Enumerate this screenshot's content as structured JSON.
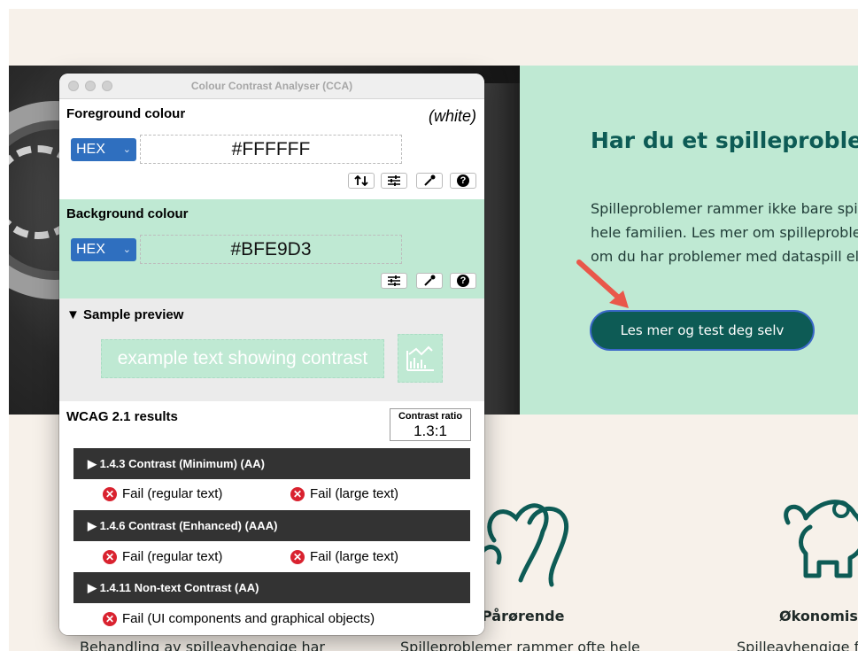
{
  "webpage": {
    "hero_title": "Har du et spilleproblem?",
    "hero_lines": [
      "Spilleproblemer rammer ikke bare spilleren, men",
      "hele familien. Les mer om spilleproblemer og hvor",
      "om du har problemer med dataspill eller pengespill."
    ],
    "hero_button": "Les mer og test deg selv",
    "cards": [
      {
        "title": "Pårørende",
        "text": "Spilleproblemer rammer ofte hele"
      },
      {
        "title": "Økonomisk",
        "text": "Spilleavhengige får"
      }
    ],
    "left_card_text": "Behandling av spilleavhengige har",
    "colors": {
      "page_bg": "#f7f1ea",
      "hero_bg": "#bfe9d3",
      "brand": "#0d5b55"
    }
  },
  "cca": {
    "window_title": "Colour Contrast Analyser (CCA)",
    "foreground": {
      "label": "Foreground colour",
      "name": "(white)",
      "format": "HEX",
      "value": "#FFFFFF"
    },
    "background": {
      "label": "Background colour",
      "format": "HEX",
      "value": "#BFE9D3"
    },
    "preview": {
      "label": "▼ Sample preview",
      "sample_text": "example text showing contrast"
    },
    "results": {
      "label": "WCAG 2.1 results",
      "ratio_label": "Contrast ratio",
      "ratio_value": "1.3:1",
      "criteria": [
        {
          "label": "▶ 1.4.3 Contrast (Minimum) (AA)",
          "items": [
            "Fail (regular text)",
            "Fail (large text)"
          ]
        },
        {
          "label": "▶ 1.4.6 Contrast (Enhanced) (AAA)",
          "items": [
            "Fail (regular text)",
            "Fail (large text)"
          ]
        },
        {
          "label": "▶ 1.4.11 Non-text Contrast (AA)",
          "items": [
            "Fail (UI components and graphical objects)"
          ]
        }
      ]
    },
    "tool_icons": [
      "swap-icon",
      "sliders-icon",
      "eyedropper-icon",
      "help-icon"
    ]
  }
}
